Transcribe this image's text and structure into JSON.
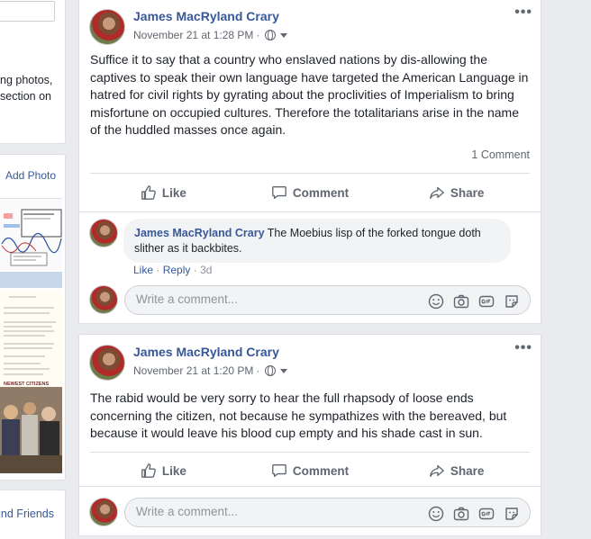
{
  "sidebar": {
    "intro_lines": [
      "ng photos,",
      "section on"
    ],
    "add_photo": "Add Photo",
    "thumbnail_caption": "NEWEST CITIZENS",
    "find_friends": "ind Friends"
  },
  "posts": [
    {
      "author": "James MacRyland Crary",
      "timestamp": "November 21 at 1:28 PM",
      "privacy_sep": "·",
      "text": "Suffice it to say that a country who enslaved nations by dis-allowing the captives to speak their own language have targeted the American Language in hatred for civil rights by gyrating about the proclivities of Imperialism to bring misfortune on occupied cultures. Therefore the totalitarians arise in the name of the huddled masses once again.",
      "comment_count": "1 Comment",
      "actions": {
        "like": "Like",
        "comment": "Comment",
        "share": "Share"
      },
      "comments": [
        {
          "author": "James MacRyland Crary",
          "text": "The Moebius lisp of the forked tongue doth slither as it backbites.",
          "like": "Like",
          "reply": "Reply",
          "sep": "·",
          "time": "3d"
        }
      ],
      "write_placeholder": "Write a comment..."
    },
    {
      "author": "James MacRyland Crary",
      "timestamp": "November 21 at 1:20 PM",
      "privacy_sep": "·",
      "text": "The rabid would be very sorry to hear the full rhapsody of loose ends concerning the citizen, not because he sympathizes with the bereaved, but because it would leave his blood cup empty and his shade cast in sun.",
      "actions": {
        "like": "Like",
        "comment": "Comment",
        "share": "Share"
      },
      "write_placeholder": "Write a comment..."
    }
  ],
  "icons": {
    "more": "more-options-icon",
    "globe": "globe-icon",
    "like": "thumbs-up-icon",
    "comment": "comment-bubble-icon",
    "share": "share-arrow-icon",
    "emoji": "emoji-icon",
    "camera": "camera-icon",
    "gif": "gif-icon",
    "sticker": "sticker-icon"
  },
  "colors": {
    "link": "#365899",
    "background": "#e9ebee",
    "muted": "#606770"
  }
}
